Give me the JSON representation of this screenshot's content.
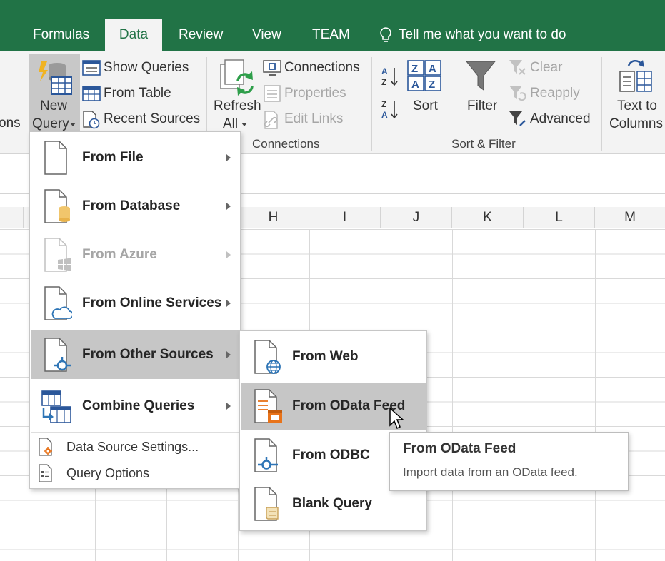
{
  "tabs": [
    {
      "label": "Formulas",
      "active": false
    },
    {
      "label": "Data",
      "active": true
    },
    {
      "label": "Review",
      "active": false
    },
    {
      "label": "View",
      "active": false
    },
    {
      "label": "TEAM",
      "active": false
    }
  ],
  "tell_me": "Tell me what you want to do",
  "ribbon": {
    "partial_left_label": "ons",
    "new_query": {
      "line1": "New",
      "line2": "Query"
    },
    "get_transform": {
      "show_queries": "Show Queries",
      "from_table": "From Table",
      "recent_sources": "Recent Sources"
    },
    "refresh_all": {
      "line1": "Refresh",
      "line2": "All"
    },
    "connections_group": {
      "connections": "Connections",
      "properties": "Properties",
      "edit_links": "Edit Links",
      "label": "Connections"
    },
    "sort_filter_group": {
      "sort": "Sort",
      "filter": "Filter",
      "clear": "Clear",
      "reapply": "Reapply",
      "advanced": "Advanced",
      "label": "Sort & Filter"
    },
    "text_to_columns": {
      "line1": "Text to",
      "line2": "Columns"
    }
  },
  "columns": [
    "H",
    "I",
    "J",
    "K",
    "L",
    "M"
  ],
  "new_query_menu": {
    "items": [
      {
        "label": "From File",
        "disabled": false,
        "submenu": true
      },
      {
        "label": "From Database",
        "disabled": false,
        "submenu": true
      },
      {
        "label": "From Azure",
        "disabled": true,
        "submenu": true
      },
      {
        "label": "From Online Services",
        "disabled": false,
        "submenu": true
      },
      {
        "label": "From Other Sources",
        "disabled": false,
        "submenu": true,
        "highlighted": true
      },
      {
        "label": "Combine Queries",
        "disabled": false,
        "submenu": true
      }
    ],
    "footer": [
      {
        "label": "Data Source Settings..."
      },
      {
        "label": "Query Options"
      }
    ]
  },
  "other_sources_menu": {
    "items": [
      {
        "label": "From Web"
      },
      {
        "label": "From OData Feed",
        "highlighted": true
      },
      {
        "label": "From ODBC"
      },
      {
        "label": "Blank Query"
      }
    ]
  },
  "tooltip": {
    "title": "From OData Feed",
    "description": "Import data from an OData feed."
  },
  "colors": {
    "excel_green": "#217346",
    "ribbon_bg": "#f3f3f3",
    "highlight": "#c6c6c6"
  }
}
